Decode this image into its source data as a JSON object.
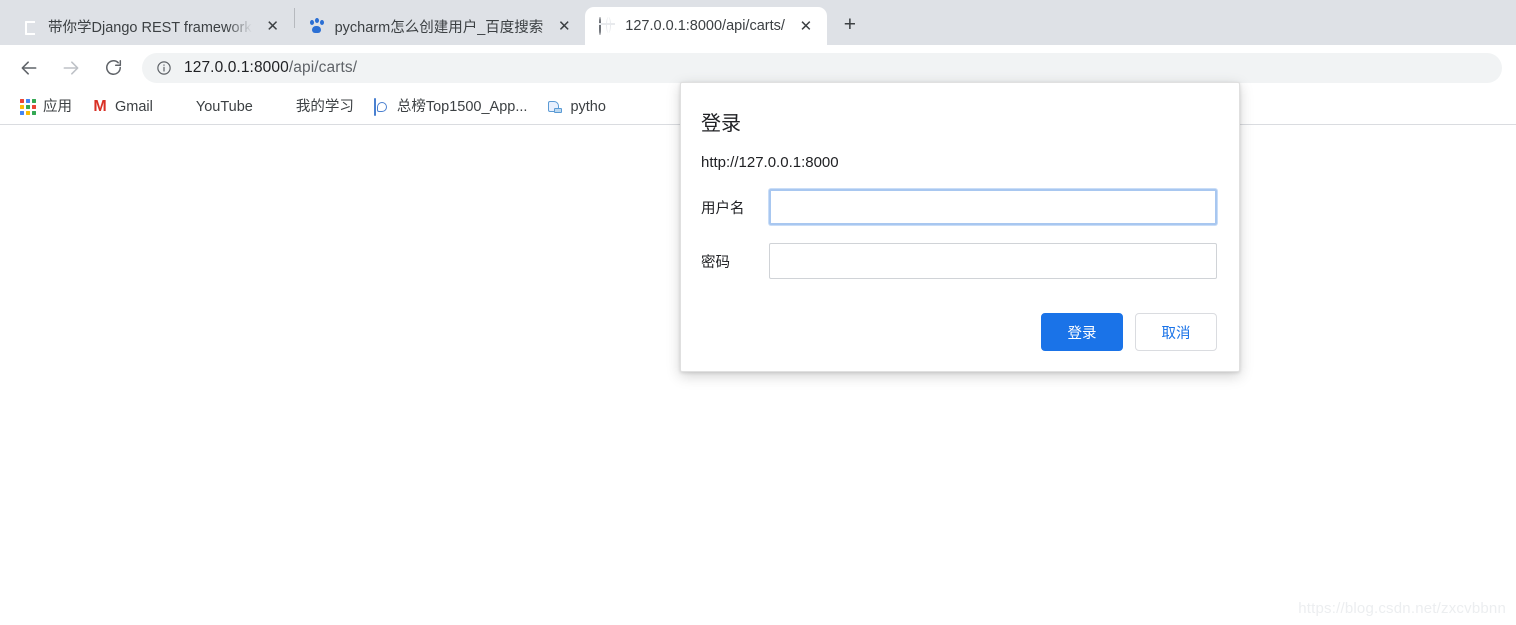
{
  "browser": {
    "tabs": [
      {
        "title": "带你学Django REST framework",
        "favicon": "book-green-icon",
        "active": false
      },
      {
        "title": "pycharm怎么创建用户_百度搜索",
        "favicon": "baidu-paw-icon",
        "active": false
      },
      {
        "title": "127.0.0.1:8000/api/carts/",
        "favicon": "globe-icon",
        "active": true
      }
    ],
    "close_label": "✕",
    "newtab_label": "+",
    "toolbar": {
      "back_icon": "back-arrow-icon",
      "forward_icon": "forward-arrow-icon",
      "reload_icon": "reload-icon",
      "page_info_icon": "info-circle-icon",
      "url_host": "127.0.0.1:8000",
      "url_path": "/api/carts/"
    },
    "bookmarks": [
      {
        "label": "应用",
        "icon": "apps-grid-icon"
      },
      {
        "label": "Gmail",
        "icon": "gmail-icon"
      },
      {
        "label": "YouTube",
        "icon": "youtube-icon"
      },
      {
        "label": "我的学习",
        "icon": "book-green-icon"
      },
      {
        "label": "总榜Top1500_App...",
        "icon": "topapp-icon"
      },
      {
        "label": "pytho",
        "icon": "scroll-blue-icon"
      }
    ]
  },
  "dialog": {
    "title": "登录",
    "origin": "http://127.0.0.1:8000",
    "username_label": "用户名",
    "username_value": "",
    "username_placeholder": "",
    "password_label": "密码",
    "password_value": "",
    "password_placeholder": "",
    "submit_label": "登录",
    "cancel_label": "取消"
  },
  "page": {
    "watermark": "https://blog.csdn.net/zxcvbbnn"
  },
  "colors": {
    "accent": "#1a73e8",
    "tabstrip_bg": "#dee1e6",
    "omnibox_bg": "#f1f3f4"
  }
}
